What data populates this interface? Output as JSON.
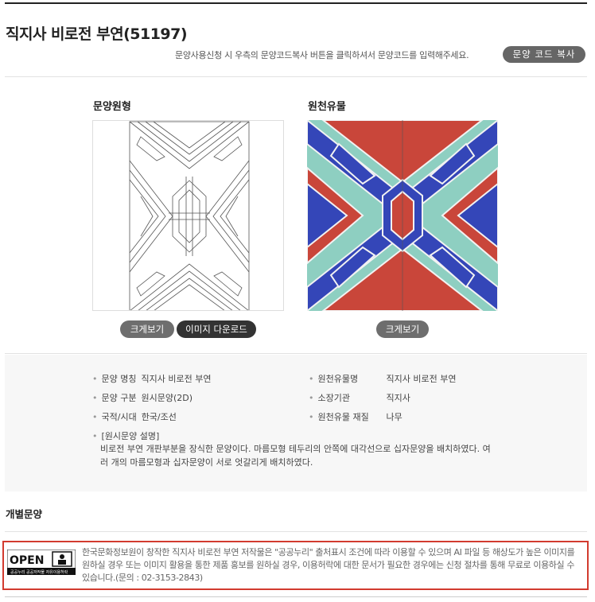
{
  "page": {
    "title": "직지사 비로전 부연(51197)",
    "notice": "문양사용신청 시 우측의 문양코드복사 버튼을 클릭하셔서 문양코드를 입력해주세요.",
    "copy_button": "문양 코드 복사"
  },
  "pattern_column": {
    "title": "문양원형",
    "enlarge_button": "크게보기",
    "download_button": "이미지 다운로드"
  },
  "original_column": {
    "title": "원천유물",
    "enlarge_button": "크게보기"
  },
  "info": {
    "left": [
      {
        "label": "문양 명칭",
        "value": "직지사 비로전 부연"
      },
      {
        "label": "문양 구분",
        "value": "원시문양(2D)"
      },
      {
        "label": "국적/시대",
        "value": "한국/조선"
      }
    ],
    "right": [
      {
        "label": "원천유물명",
        "value": "직지사 비로전 부연"
      },
      {
        "label": "소장기관",
        "value": "직지사"
      },
      {
        "label": "원천유물 재질",
        "value": "나무"
      }
    ],
    "description_label": "[원시문양 설명]",
    "description": "비로전 부연 개판부분을 장식한 문양이다. 마름모형 테두리의 안쪽에 대각선으로 십자문양을 배치하였다. 여러 개의 마름모형과 십자문양이 서로 엇갈리게 배치하였다."
  },
  "section": {
    "individual_title": "개별문양"
  },
  "license": {
    "logo_text": "OPEN",
    "logo_sub": "공공누리 공공저작물 자유이용허락",
    "text": "한국문화정보원이 창작한 직지사 비로전 부연 저작물은 \"공공누리\" 출처표시 조건에 따라 이용할 수 있으며 AI 파일 등 해상도가 높은 이미지를 원하실 경우 또는 이미지 활용을 통한 제품 홍보를 원하실 경우, 이용허락에 대한 문서가 필요한 경우에는 신청 절차를 통해 무료로 이용하실 수 있습니다.(문의 : 02-3153-2843)"
  },
  "colors": {
    "red": "#c9463a",
    "blue": "#3446b8",
    "teal": "#8ecfc1",
    "accent_border": "#d23b2f"
  }
}
